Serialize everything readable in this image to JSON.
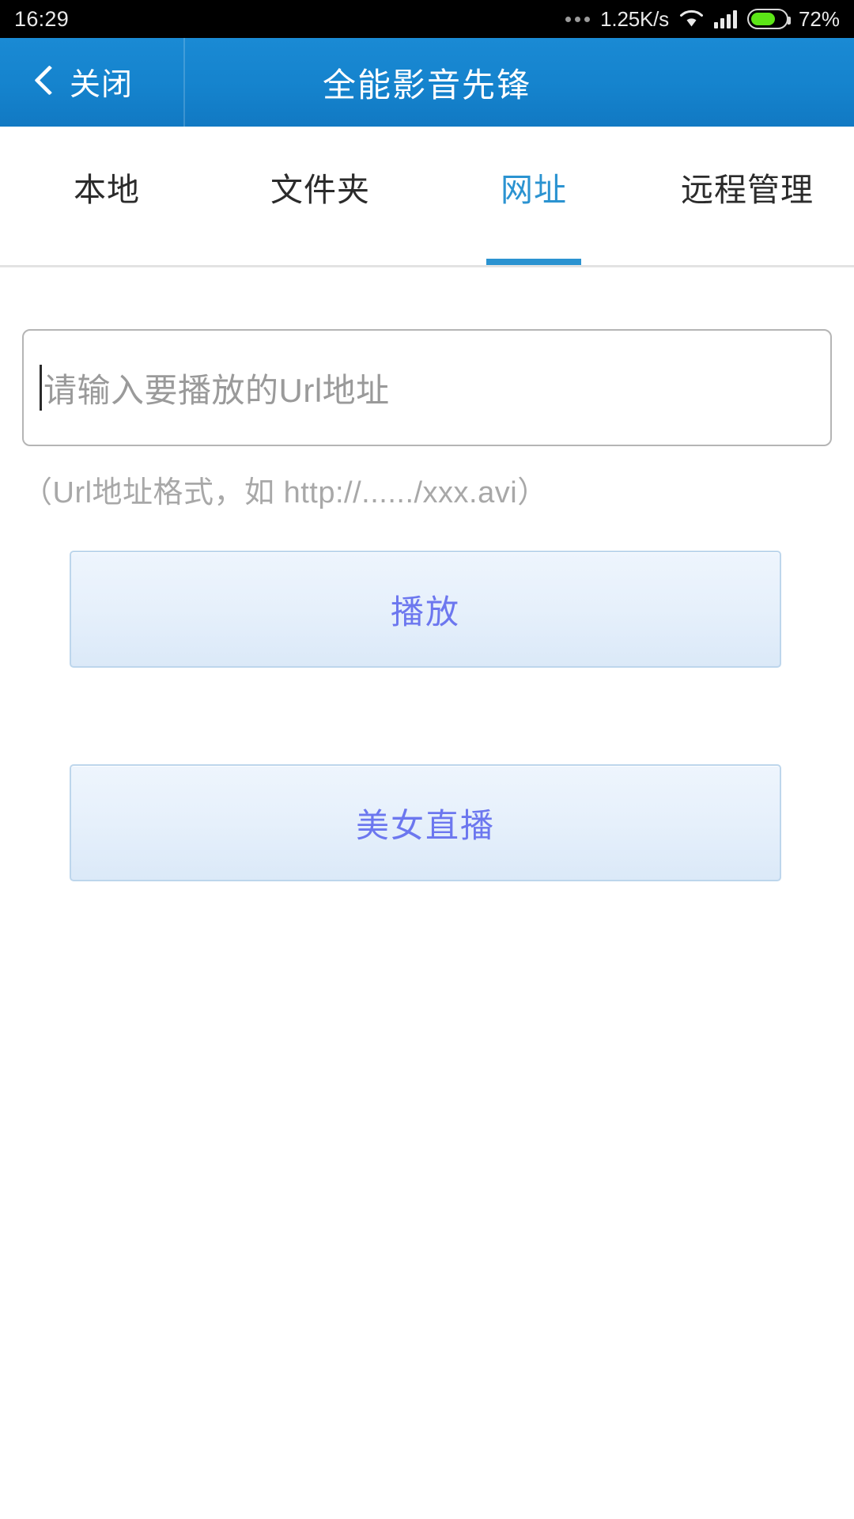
{
  "statusbar": {
    "time": "16:29",
    "dots_icon": "overflow-dots-icon",
    "network_speed": "1.25K/s",
    "wifi_icon": "wifi-icon",
    "signal_icon": "cellular-signal-icon",
    "battery_icon": "battery-icon",
    "battery_percent": "72%",
    "battery_level": 72,
    "battery_color": "#5ce617",
    "background": "#000000"
  },
  "header": {
    "back_icon": "chevron-left-icon",
    "back_label": "关闭",
    "title": "全能影音先锋",
    "background": "#1583cd",
    "text_color": "#ffffff"
  },
  "tabs": {
    "active_index": 2,
    "accent_color": "#2b93d1",
    "items": [
      {
        "label": "本地"
      },
      {
        "label": "文件夹"
      },
      {
        "label": "网址"
      },
      {
        "label": "远程管理"
      }
    ]
  },
  "main": {
    "url_field": {
      "value": "",
      "placeholder": "请输入要播放的Url地址",
      "caret_visible": true
    },
    "hint": "（Url地址格式，如 http://....../xxx.avi）",
    "buttons": [
      {
        "label": "播放",
        "name": "play-button"
      },
      {
        "label": "美女直播",
        "name": "live-stream-button"
      }
    ],
    "button_text_color": "#6c77ef",
    "button_background": "#e6f0fb"
  }
}
